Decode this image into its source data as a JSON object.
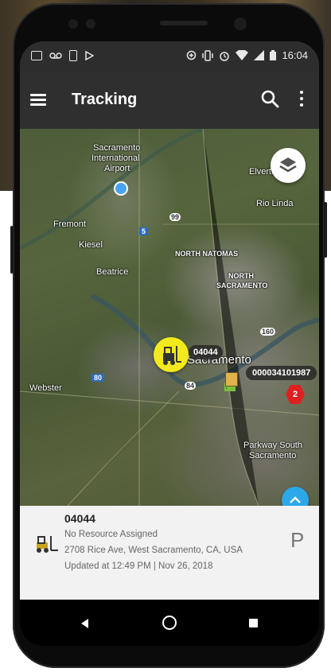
{
  "status_bar": {
    "time": "16:04",
    "left_icons": [
      "gmail-icon",
      "voicemail-icon",
      "battery-saver-icon",
      "play-store-icon"
    ],
    "right_icons": [
      "data-saver-icon",
      "vibrate-icon",
      "alarm-icon",
      "wifi-icon",
      "signal-icon",
      "battery-icon"
    ]
  },
  "app_bar": {
    "title": "Tracking",
    "menu_icon": "menu-icon",
    "search_icon": "search-icon",
    "more_icon": "more-vert-icon"
  },
  "map": {
    "labels": {
      "airport_line1": "Sacramento",
      "airport_line2": "International",
      "airport_line3": "Airport",
      "elverta": "Elverta",
      "rio_linda": "Rio Linda",
      "fremont": "Fremont",
      "kiesel": "Kiesel",
      "beatrice": "Beatrice",
      "north_natomas": "NORTH NATOMAS",
      "north_sac_line1": "NORTH",
      "north_sac_line2": "SACRAMENTO",
      "sacramento": "Sacramento",
      "webster": "Webster",
      "parkway_line1": "Parkway South",
      "parkway_line2": "Sacramento",
      "hwy_99": "99",
      "hwy_5": "5",
      "hwy_160": "160",
      "hwy_80": "80",
      "hwy_84": "84",
      "hwy_80b": "80"
    },
    "vehicle_marker_label": "04044",
    "asset_label": "000034101987",
    "alert_count": "2"
  },
  "info_panel": {
    "vehicle_id": "04044",
    "resource": "No Resource Assigned",
    "address": "2708 Rice Ave, West Sacramento, CA, USA",
    "updated": "Updated at 12:49 PM | Nov 26, 2018",
    "status_letter": "P"
  },
  "colors": {
    "app_bar": "#2f2f2f",
    "marker_yellow": "#f3e91c",
    "accent_blue": "#2aa8e8",
    "alert_red": "#e02020"
  }
}
